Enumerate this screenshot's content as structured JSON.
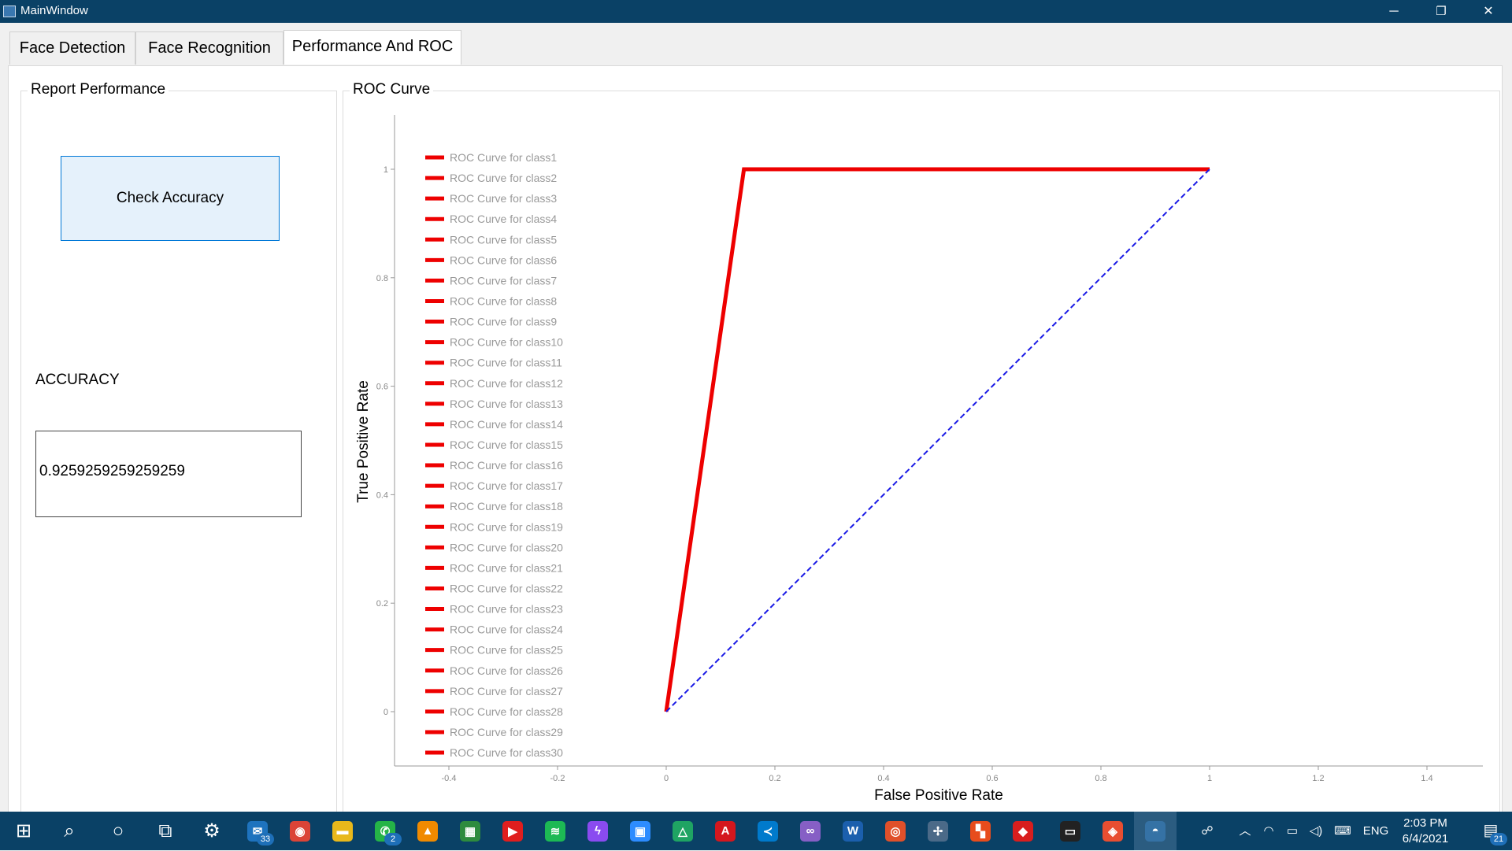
{
  "window": {
    "title": "MainWindow",
    "minimize": "─",
    "restore": "❐",
    "close": "✕"
  },
  "tabs": [
    {
      "label": "Face Detection",
      "active": false
    },
    {
      "label": "Face Recognition",
      "active": false
    },
    {
      "label": "Performance And ROC",
      "active": true
    }
  ],
  "report_panel": {
    "title": "Report Performance",
    "check_button": "Check Accuracy",
    "accuracy_label": "ACCURACY",
    "accuracy_value": "0.9259259259259259"
  },
  "roc_panel": {
    "title": "ROC Curve"
  },
  "chart_data": {
    "type": "line",
    "xlabel": "False Positive Rate",
    "ylabel": "True Positive Rate",
    "xlim": [
      -0.5,
      1.5
    ],
    "ylim": [
      -0.1,
      1.1
    ],
    "xticks": [
      -0.4,
      -0.2,
      0,
      0.2,
      0.4,
      0.6,
      0.8,
      1,
      1.2,
      1.4
    ],
    "yticks": [
      0,
      0.2,
      0.4,
      0.6,
      0.8,
      1
    ],
    "legend_position": "top-left",
    "grid": false,
    "series": [
      {
        "x": [
          0,
          0.143,
          1
        ],
        "y": [
          0,
          1,
          1
        ],
        "color": "#ee0000",
        "style": "solid"
      },
      {
        "x": [
          0,
          1
        ],
        "y": [
          0,
          1
        ],
        "color": "#1a1ae6",
        "style": "dashed"
      }
    ],
    "legend": [
      "ROC Curve for class1",
      "ROC Curve for class2",
      "ROC Curve for class3",
      "ROC Curve for class4",
      "ROC Curve for class5",
      "ROC Curve for class6",
      "ROC Curve for class7",
      "ROC Curve for class8",
      "ROC Curve for class9",
      "ROC Curve for class10",
      "ROC Curve for class11",
      "ROC Curve for class12",
      "ROC Curve for class13",
      "ROC Curve for class14",
      "ROC Curve for class15",
      "ROC Curve for class16",
      "ROC Curve for class17",
      "ROC Curve for class18",
      "ROC Curve for class19",
      "ROC Curve for class20",
      "ROC Curve for class21",
      "ROC Curve for class22",
      "ROC Curve for class23",
      "ROC Curve for class24",
      "ROC Curve for class25",
      "ROC Curve for class26",
      "ROC Curve for class27",
      "ROC Curve for class28",
      "ROC Curve for class29",
      "ROC Curve for class30"
    ],
    "legend_color": "#ee0000"
  },
  "taskbar": {
    "apps": [
      {
        "icon": "windows-start-icon",
        "glyph": "⊞",
        "color": ""
      },
      {
        "icon": "search-icon",
        "glyph": "⌕",
        "color": ""
      },
      {
        "icon": "cortana-icon",
        "glyph": "○",
        "color": ""
      },
      {
        "icon": "task-view-icon",
        "glyph": "⧉",
        "color": ""
      },
      {
        "icon": "settings-gear-icon",
        "glyph": "⚙",
        "color": ""
      },
      {
        "icon": "mail-icon",
        "glyph": "✉",
        "color": "#1e73be",
        "badge": "33"
      },
      {
        "icon": "chrome-icon",
        "glyph": "◉",
        "color": "#db4437"
      },
      {
        "icon": "file-explorer-icon",
        "glyph": "▬",
        "color": "#e8b81b"
      },
      {
        "icon": "whatsapp-icon",
        "glyph": "✆",
        "color": "#25b447",
        "badge": "2"
      },
      {
        "icon": "vlc-icon",
        "glyph": "▲",
        "color": "#f08a00"
      },
      {
        "icon": "image-editor-icon",
        "glyph": "▦",
        "color": "#2e8b3e"
      },
      {
        "icon": "video-player-icon",
        "glyph": "▶",
        "color": "#e01e1e"
      },
      {
        "icon": "spotify-icon",
        "glyph": "≋",
        "color": "#1db954"
      },
      {
        "icon": "messenger-icon",
        "glyph": "ϟ",
        "color": "#8a4bf0"
      },
      {
        "icon": "zoom-icon",
        "glyph": "▣",
        "color": "#2d8cff"
      },
      {
        "icon": "google-drive-icon",
        "glyph": "△",
        "color": "#1fa463"
      },
      {
        "icon": "acrobat-icon",
        "glyph": "A",
        "color": "#d4171e"
      },
      {
        "icon": "vscode-icon",
        "glyph": "≺",
        "color": "#007acc"
      },
      {
        "icon": "visual-studio-icon",
        "glyph": "∞",
        "color": "#865fc5"
      },
      {
        "icon": "word-icon",
        "glyph": "W",
        "color": "#1b5fad"
      },
      {
        "icon": "anaconda-icon",
        "glyph": "◎",
        "color": "#e0502a"
      },
      {
        "icon": "drone-app-icon",
        "glyph": "✢",
        "color": "#4b6a88"
      },
      {
        "icon": "office-icon",
        "glyph": "▚",
        "color": "#e74c1c"
      },
      {
        "icon": "3d-box-icon",
        "glyph": "◆",
        "color": "#d91e1e"
      },
      {
        "icon": "terminal-icon",
        "glyph": "▭",
        "color": "#222222"
      },
      {
        "icon": "git-icon",
        "glyph": "◈",
        "color": "#e84e31"
      },
      {
        "icon": "python-icon",
        "glyph": "◓",
        "color": "#3572a5",
        "active": true
      }
    ],
    "tray": {
      "people": "☍",
      "chevron": "︿",
      "wifi": "◠",
      "battery": "▭",
      "volume": "◁)",
      "keyboard": "⌨",
      "language": "ENG",
      "time": "2:03 PM",
      "date": "6/4/2021",
      "notifications": "21"
    }
  }
}
